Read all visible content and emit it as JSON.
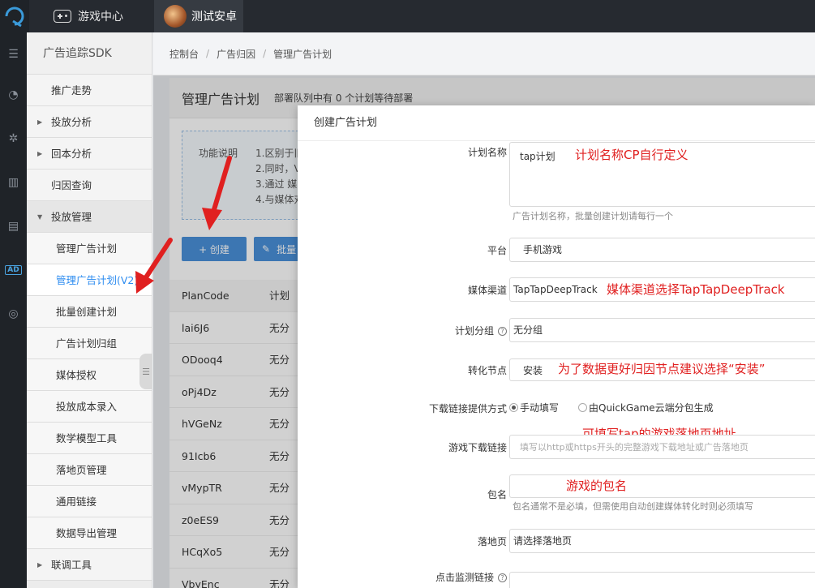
{
  "topbar": {
    "game_center": "游戏中心",
    "project": "测试安卓"
  },
  "sidebar": {
    "title": "广告追踪SDK",
    "items": [
      {
        "label": "推广走势"
      },
      {
        "label": "投放分析"
      },
      {
        "label": "回本分析"
      },
      {
        "label": "归因查询"
      },
      {
        "label": "投放管理"
      },
      {
        "label": "管理广告计划"
      },
      {
        "label": "管理广告计划(V2)"
      },
      {
        "label": "批量创建计划"
      },
      {
        "label": "广告计划归组"
      },
      {
        "label": "媒体授权"
      },
      {
        "label": "投放成本录入"
      },
      {
        "label": "数学模型工具"
      },
      {
        "label": "落地页管理"
      },
      {
        "label": "通用链接"
      },
      {
        "label": "数据导出管理"
      },
      {
        "label": "联调工具"
      }
    ]
  },
  "breadcrumb": [
    "控制台",
    "广告归因",
    "管理广告计划"
  ],
  "panel": {
    "title": "管理广告计划",
    "note": "部署队列中有 0 个计划等待部署",
    "func_label": "功能说明",
    "func_lines": [
      "1.区别于旧",
      "2.同时，V",
      "3.通过 媒",
      "4.与媒体对"
    ],
    "create_label": "+ 创建",
    "batch_label": "批量"
  },
  "table": {
    "headers": [
      "PlanCode",
      "计划"
    ],
    "rows": [
      [
        "lai6J6",
        "无分"
      ],
      [
        "ODooq4",
        "无分"
      ],
      [
        "oPj4Dz",
        "无分"
      ],
      [
        "hVGeNz",
        "无分"
      ],
      [
        "91Icb6",
        "无分"
      ],
      [
        "vMypTR",
        "无分"
      ],
      [
        "z0eES9",
        "无分"
      ],
      [
        "HCqXo5",
        "无分"
      ],
      [
        "VbyEnc",
        "无分"
      ]
    ]
  },
  "dialog": {
    "title": "创建广告计划",
    "plan_name_label": "计划名称",
    "plan_name_value": "tap计划",
    "plan_name_help": "广告计划名称，批量创建计划请每行一个",
    "platform_label": "平台",
    "platform_value": "手机游戏",
    "channel_label": "媒体渠道",
    "channel_value": "TapTapDeepTrack",
    "group_label": "计划分组",
    "group_value": "无分组",
    "node_label": "转化节点",
    "node_value": "安装",
    "download_label": "下载链接提供方式",
    "download_opt1": "手动填写",
    "download_opt2": "由QuickGame云端分包生成",
    "game_link_label": "游戏下载链接",
    "game_link_placeholder": "填写以http或https开头的完整游戏下载地址或广告落地页",
    "package_label": "包名",
    "package_help": "包名通常不是必填，但需使用自动创建媒体转化时则必须填写",
    "landing_label": "落地页",
    "landing_value": "请选择落地页",
    "click_label": "点击监测链接"
  },
  "annotations": {
    "a1": "计划名称CP自行定义",
    "a2": "媒体渠道选择TapTapDeepTrack",
    "a3": "为了数据更好归因节点建议选择“安装”",
    "a4": "可填写tap的游戏落地页地址",
    "a5": "游戏的包名"
  },
  "colors": {
    "accent": "#4a90d9",
    "active_menu": "#2d8cf0",
    "annotation": "#e02020"
  }
}
